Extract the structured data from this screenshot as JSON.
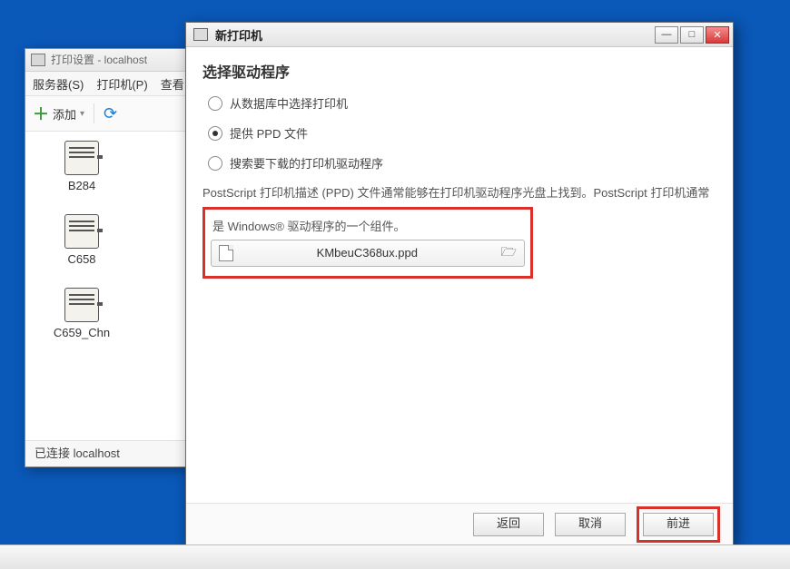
{
  "bg": {
    "title": "打印设置 - localhost",
    "menu": {
      "server": "服务器(S)",
      "printer": "打印机(P)",
      "view": "查看"
    },
    "toolbar": {
      "add": "添加"
    },
    "printers": [
      {
        "name": "B284"
      },
      {
        "name": "C658"
      },
      {
        "name": "C659_Chn"
      }
    ],
    "status": "已连接 localhost"
  },
  "dlg": {
    "title": "新打印机",
    "heading": "选择驱动程序",
    "opt_db": "从数据库中选择打印机",
    "opt_ppd": "提供 PPD 文件",
    "opt_search": "搜索要下载的打印机驱动程序",
    "desc_line1": "PostScript 打印机描述 (PPD) 文件通常能够在打印机驱动程序光盘上找到。PostScript 打印机通常",
    "desc_line2": "是 Windows® 驱动程序的一个组件。",
    "file_name": "KMbeuC368ux.ppd",
    "btn_back": "返回",
    "btn_cancel": "取消",
    "btn_forward": "前进"
  }
}
